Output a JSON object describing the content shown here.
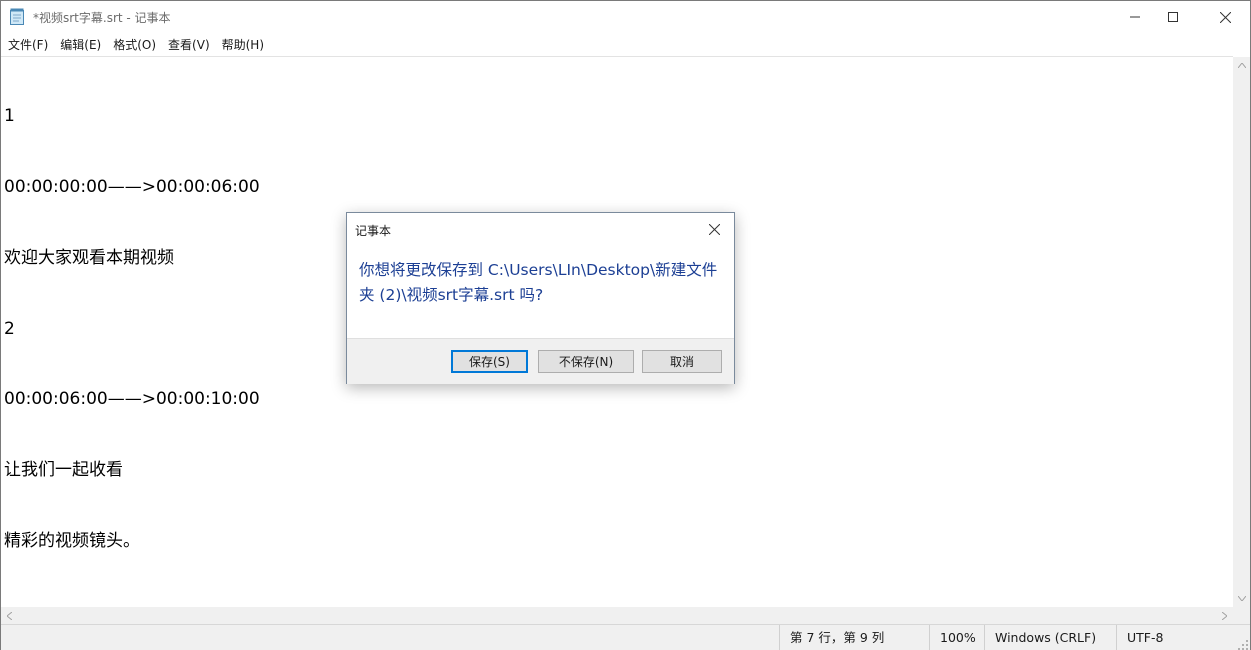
{
  "window": {
    "title": "*视频srt字幕.srt - 记事本"
  },
  "menu": [
    "文件(F)",
    "编辑(E)",
    "格式(O)",
    "查看(V)",
    "帮助(H)"
  ],
  "editor": {
    "lines": [
      "1",
      "00:00:00:00——>00:00:06:00",
      "欢迎大家观看本期视频",
      "2",
      "00:00:06:00——>00:00:10:00",
      "让我们一起收看",
      "精彩的视频镜头。"
    ]
  },
  "status": {
    "position": "第 7 行，第 9 列",
    "zoom": "100%",
    "line_ending": "Windows (CRLF)",
    "encoding": "UTF-8"
  },
  "dialog": {
    "title": "记事本",
    "message": "你想将更改保存到 C:\\Users\\LIn\\Desktop\\新建文件夹 (2)\\视频srt字幕.srt 吗?",
    "save_label": "保存(S)",
    "nosave_label": "不保存(N)",
    "cancel_label": "取消"
  },
  "colors": {
    "dialog_message": "#1c3f94",
    "default_button_border": "#0078d7"
  }
}
